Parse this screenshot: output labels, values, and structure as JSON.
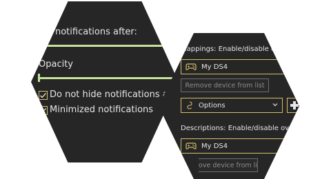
{
  "left_panel": {
    "hide_after_label": "ide notifications after:",
    "opacity_label": "Opacity",
    "checkboxes": [
      {
        "label": "Do not hide notifications about Shift",
        "checked": true
      },
      {
        "label": "Minimized notifications",
        "checked": true
      }
    ]
  },
  "right_panel": {
    "mappings_label": "Mappings: Enable/disable overlay wi",
    "mappings_device": "My DS4",
    "remove_device_label": "Remove device from list",
    "options_label": "Options",
    "descriptions_label": "Descriptions: Enable/disable overlay with",
    "descriptions_device": "My DS4",
    "remove_device_partial_label": "ove device from li"
  },
  "colors": {
    "panel_background": "#262626",
    "accent_green": "#c7e39a",
    "accent_gold": "#d6c06a",
    "text": "#e6e6e6",
    "disabled_text": "#8d8d8d"
  },
  "icons": {
    "controller": "gamepad-icon",
    "options": "hook-icon",
    "dropdown": "chevron-down-icon",
    "side": "controller-glyph-icon"
  }
}
